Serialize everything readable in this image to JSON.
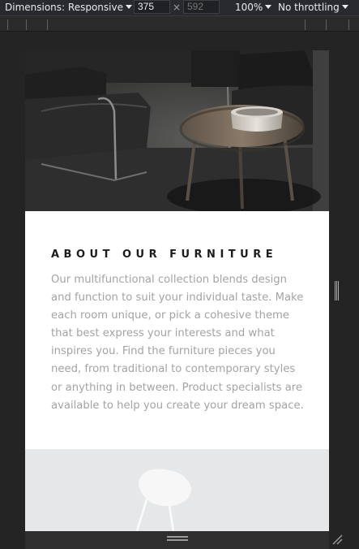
{
  "toolbar": {
    "dimensions_label": "Dimensions: Responsive",
    "width_value": "375",
    "times_sign": "×",
    "height_placeholder": "592",
    "zoom_label": "100%",
    "throttle_label": "No throttling"
  },
  "page": {
    "heading": "ABOUT OUR FURNITURE",
    "body": "Our multifunctional collection blends design and function to suit your individual taste. Make each room unique, or pick a cohesive theme that best express your interests and what inspires you. Find the furniture pieces you need, from traditional to contemporary styles or anything in between. Product specialists are available to help you create your dream space."
  },
  "colors": {
    "heading": "#1c1c1c",
    "body_text": "#a3a3a3",
    "devtools_bg": "#292a2d"
  }
}
